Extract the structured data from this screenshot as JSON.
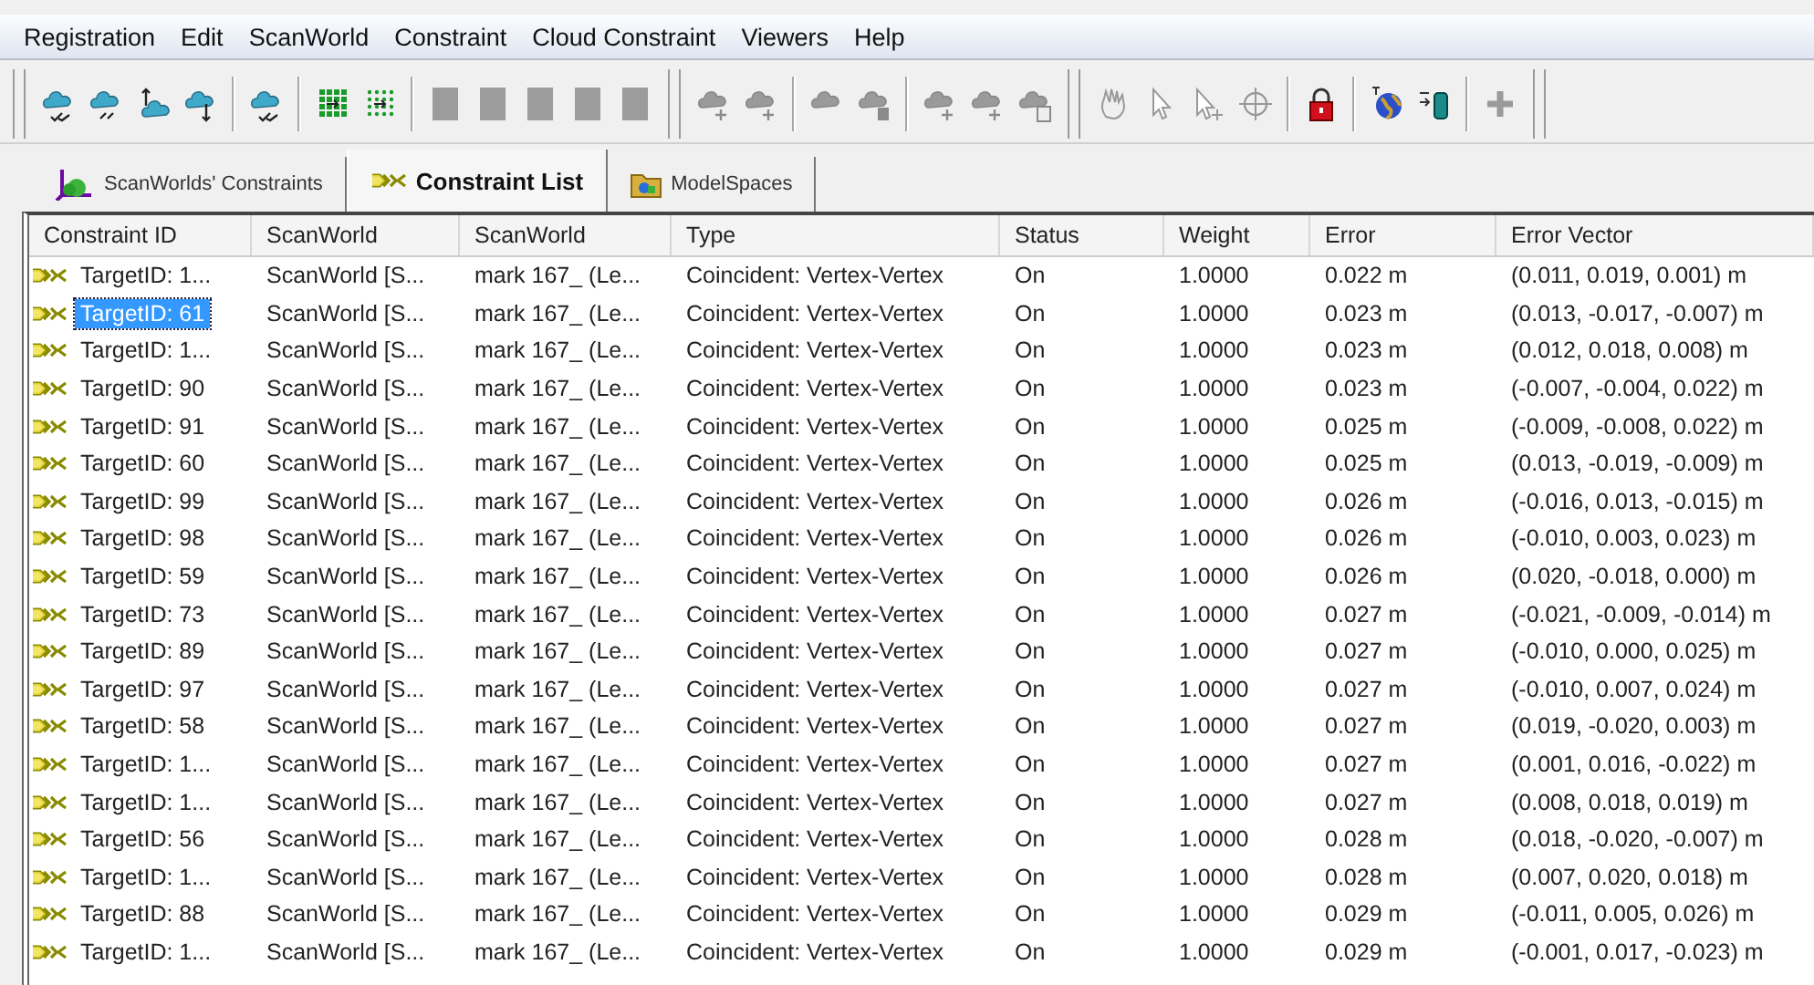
{
  "menu": [
    "Registration",
    "Edit",
    "ScanWorld",
    "Constraint",
    "Cloud Constraint",
    "Viewers",
    "Help"
  ],
  "toolbar": [
    {
      "kind": "grip"
    },
    {
      "kind": "cloud-check",
      "disabled": false
    },
    {
      "kind": "cloud-tilt",
      "disabled": false
    },
    {
      "kind": "cloud-up",
      "disabled": false
    },
    {
      "kind": "cloud-down",
      "disabled": false
    },
    {
      "kind": "separator"
    },
    {
      "kind": "cloud-check",
      "disabled": false
    },
    {
      "kind": "separator"
    },
    {
      "kind": "grid",
      "disabled": false
    },
    {
      "kind": "grid-dotted",
      "disabled": false
    },
    {
      "kind": "separator"
    },
    {
      "kind": "square",
      "disabled": true
    },
    {
      "kind": "square",
      "disabled": true
    },
    {
      "kind": "square",
      "disabled": true
    },
    {
      "kind": "square",
      "disabled": true
    },
    {
      "kind": "square",
      "disabled": true
    },
    {
      "kind": "grip"
    },
    {
      "kind": "cloud-plus",
      "disabled": true
    },
    {
      "kind": "cloud-plus",
      "disabled": true
    },
    {
      "kind": "separator"
    },
    {
      "kind": "cloud",
      "disabled": true
    },
    {
      "kind": "cloud-info",
      "disabled": true
    },
    {
      "kind": "separator"
    },
    {
      "kind": "cloud-plus",
      "disabled": true
    },
    {
      "kind": "cloud-plus",
      "disabled": true
    },
    {
      "kind": "cloud-doc",
      "disabled": true
    },
    {
      "kind": "grip"
    },
    {
      "kind": "hand",
      "disabled": true
    },
    {
      "kind": "cursor",
      "disabled": true
    },
    {
      "kind": "cursor-plus",
      "disabled": true
    },
    {
      "kind": "crosshair",
      "disabled": true
    },
    {
      "kind": "separator"
    },
    {
      "kind": "lock",
      "disabled": false
    },
    {
      "kind": "separator"
    },
    {
      "kind": "globe",
      "disabled": false
    },
    {
      "kind": "cylinder",
      "disabled": false
    },
    {
      "kind": "separator"
    },
    {
      "kind": "plus",
      "disabled": true
    },
    {
      "kind": "grip"
    }
  ],
  "tabs": [
    {
      "label": "ScanWorlds' Constraints",
      "kind": "axes",
      "selected": false
    },
    {
      "label": "Constraint List",
      "kind": "chain",
      "selected": true
    },
    {
      "label": "ModelSpaces",
      "kind": "folder",
      "selected": false
    }
  ],
  "table": {
    "columns": [
      "Constraint ID",
      "ScanWorld",
      "ScanWorld",
      "Type",
      "Status",
      "Weight",
      "Error",
      "Error Vector"
    ],
    "rows": [
      {
        "id": "TargetID: 1...",
        "scanworld_1": "ScanWorld [S...",
        "scanworld_2": "mark 167_ (Le...",
        "type": "Coincident: Vertex-Vertex",
        "status": "On",
        "weight": "1.0000",
        "error": "0.022 m",
        "error_vector": "(0.011, 0.019, 0.001) m",
        "selected": false
      },
      {
        "id": "TargetID: 61",
        "scanworld_1": "ScanWorld [S...",
        "scanworld_2": "mark 167_ (Le...",
        "type": "Coincident: Vertex-Vertex",
        "status": "On",
        "weight": "1.0000",
        "error": "0.023 m",
        "error_vector": "(0.013, -0.017, -0.007) m",
        "selected": true
      },
      {
        "id": "TargetID: 1...",
        "scanworld_1": "ScanWorld [S...",
        "scanworld_2": "mark 167_ (Le...",
        "type": "Coincident: Vertex-Vertex",
        "status": "On",
        "weight": "1.0000",
        "error": "0.023 m",
        "error_vector": "(0.012, 0.018, 0.008) m",
        "selected": false
      },
      {
        "id": "TargetID: 90",
        "scanworld_1": "ScanWorld [S...",
        "scanworld_2": "mark 167_ (Le...",
        "type": "Coincident: Vertex-Vertex",
        "status": "On",
        "weight": "1.0000",
        "error": "0.023 m",
        "error_vector": "(-0.007, -0.004, 0.022) m",
        "selected": false
      },
      {
        "id": "TargetID: 91",
        "scanworld_1": "ScanWorld [S...",
        "scanworld_2": "mark 167_ (Le...",
        "type": "Coincident: Vertex-Vertex",
        "status": "On",
        "weight": "1.0000",
        "error": "0.025 m",
        "error_vector": "(-0.009, -0.008, 0.022) m",
        "selected": false
      },
      {
        "id": "TargetID: 60",
        "scanworld_1": "ScanWorld [S...",
        "scanworld_2": "mark 167_ (Le...",
        "type": "Coincident: Vertex-Vertex",
        "status": "On",
        "weight": "1.0000",
        "error": "0.025 m",
        "error_vector": "(0.013, -0.019, -0.009) m",
        "selected": false
      },
      {
        "id": "TargetID: 99",
        "scanworld_1": "ScanWorld [S...",
        "scanworld_2": "mark 167_ (Le...",
        "type": "Coincident: Vertex-Vertex",
        "status": "On",
        "weight": "1.0000",
        "error": "0.026 m",
        "error_vector": "(-0.016, 0.013, -0.015) m",
        "selected": false
      },
      {
        "id": "TargetID: 98",
        "scanworld_1": "ScanWorld [S...",
        "scanworld_2": "mark 167_ (Le...",
        "type": "Coincident: Vertex-Vertex",
        "status": "On",
        "weight": "1.0000",
        "error": "0.026 m",
        "error_vector": "(-0.010, 0.003, 0.023) m",
        "selected": false
      },
      {
        "id": "TargetID: 59",
        "scanworld_1": "ScanWorld [S...",
        "scanworld_2": "mark 167_ (Le...",
        "type": "Coincident: Vertex-Vertex",
        "status": "On",
        "weight": "1.0000",
        "error": "0.026 m",
        "error_vector": "(0.020, -0.018, 0.000) m",
        "selected": false
      },
      {
        "id": "TargetID: 73",
        "scanworld_1": "ScanWorld [S...",
        "scanworld_2": "mark 167_ (Le...",
        "type": "Coincident: Vertex-Vertex",
        "status": "On",
        "weight": "1.0000",
        "error": "0.027 m",
        "error_vector": "(-0.021, -0.009, -0.014) m",
        "selected": false
      },
      {
        "id": "TargetID: 89",
        "scanworld_1": "ScanWorld [S...",
        "scanworld_2": "mark 167_ (Le...",
        "type": "Coincident: Vertex-Vertex",
        "status": "On",
        "weight": "1.0000",
        "error": "0.027 m",
        "error_vector": "(-0.010, 0.000, 0.025) m",
        "selected": false
      },
      {
        "id": "TargetID: 97",
        "scanworld_1": "ScanWorld [S...",
        "scanworld_2": "mark 167_ (Le...",
        "type": "Coincident: Vertex-Vertex",
        "status": "On",
        "weight": "1.0000",
        "error": "0.027 m",
        "error_vector": "(-0.010, 0.007, 0.024) m",
        "selected": false
      },
      {
        "id": "TargetID: 58",
        "scanworld_1": "ScanWorld [S...",
        "scanworld_2": "mark 167_ (Le...",
        "type": "Coincident: Vertex-Vertex",
        "status": "On",
        "weight": "1.0000",
        "error": "0.027 m",
        "error_vector": "(0.019, -0.020, 0.003) m",
        "selected": false
      },
      {
        "id": "TargetID: 1...",
        "scanworld_1": "ScanWorld [S...",
        "scanworld_2": "mark 167_ (Le...",
        "type": "Coincident: Vertex-Vertex",
        "status": "On",
        "weight": "1.0000",
        "error": "0.027 m",
        "error_vector": "(0.001, 0.016, -0.022) m",
        "selected": false
      },
      {
        "id": "TargetID: 1...",
        "scanworld_1": "ScanWorld [S...",
        "scanworld_2": "mark 167_ (Le...",
        "type": "Coincident: Vertex-Vertex",
        "status": "On",
        "weight": "1.0000",
        "error": "0.027 m",
        "error_vector": "(0.008, 0.018, 0.019) m",
        "selected": false
      },
      {
        "id": "TargetID: 56",
        "scanworld_1": "ScanWorld [S...",
        "scanworld_2": "mark 167_ (Le...",
        "type": "Coincident: Vertex-Vertex",
        "status": "On",
        "weight": "1.0000",
        "error": "0.028 m",
        "error_vector": "(0.018, -0.020, -0.007) m",
        "selected": false
      },
      {
        "id": "TargetID: 1...",
        "scanworld_1": "ScanWorld [S...",
        "scanworld_2": "mark 167_ (Le...",
        "type": "Coincident: Vertex-Vertex",
        "status": "On",
        "weight": "1.0000",
        "error": "0.028 m",
        "error_vector": "(0.007, 0.020, 0.018) m",
        "selected": false
      },
      {
        "id": "TargetID: 88",
        "scanworld_1": "ScanWorld [S...",
        "scanworld_2": "mark 167_ (Le...",
        "type": "Coincident: Vertex-Vertex",
        "status": "On",
        "weight": "1.0000",
        "error": "0.029 m",
        "error_vector": "(-0.011, 0.005, 0.026) m",
        "selected": false
      },
      {
        "id": "TargetID: 1...",
        "scanworld_1": "ScanWorld [S...",
        "scanworld_2": "mark 167_ (Le...",
        "type": "Coincident: Vertex-Vertex",
        "status": "On",
        "weight": "1.0000",
        "error": "0.029 m",
        "error_vector": "(-0.001, 0.017, -0.023) m",
        "selected": false
      }
    ]
  }
}
